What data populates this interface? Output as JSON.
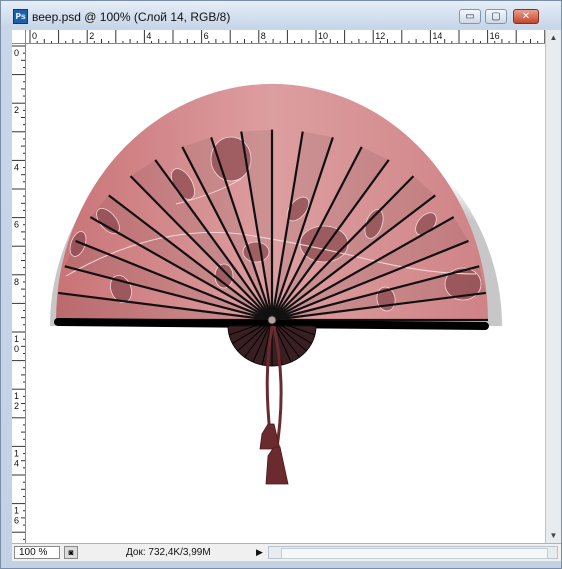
{
  "window": {
    "title": "веер.psd @ 100% (Слой 14, RGB/8)",
    "app_icon": "Ps",
    "buttons": {
      "minimize": "▭",
      "maximize": "▢",
      "close": "✕"
    }
  },
  "rulers": {
    "horizontal_labels": [
      "0",
      "2",
      "4",
      "6",
      "8",
      "10",
      "12",
      "14",
      "16"
    ],
    "vertical_labels": [
      "0",
      "2",
      "4",
      "6",
      "8",
      "1\n0",
      "1\n2",
      "1\n4",
      "1\n6"
    ]
  },
  "status": {
    "zoom": "100 %",
    "doc_info": "Док: 732,4K/3,99M",
    "menu_arrow": "▶"
  },
  "colors": {
    "fan_pink": "#d98f91",
    "fan_dark": "#8c4b50",
    "rib": "#111111",
    "tassel": "#6b2a2e"
  }
}
